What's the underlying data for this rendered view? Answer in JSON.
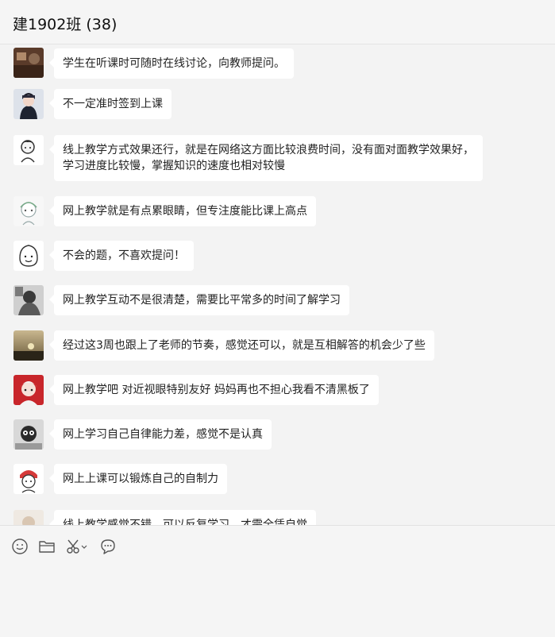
{
  "window": {
    "title": "建1902班 (38)"
  },
  "messages": [
    {
      "text": [
        "学生在听课时可随时在线讨论，向教师提问。"
      ]
    },
    {
      "text": [
        "不一定准时签到上课"
      ]
    },
    {
      "text": [
        "线上教学方式效果还行，就是在网络这方面比较浪费时间，没有面对面教学效果好，",
        "学习进度比较慢，掌握知识的速度也相对较慢"
      ]
    },
    {
      "text": [
        "网上教学就是有点累眼睛，但专注度能比课上高点"
      ]
    },
    {
      "text": [
        "不会的题，不喜欢提问！"
      ]
    },
    {
      "text": [
        "网上教学互动不是很清楚，需要比平常多的时间了解学习"
      ]
    },
    {
      "text": [
        "经过这3周也跟上了老师的节奏，感觉还可以，就是互相解答的机会少了些"
      ]
    },
    {
      "text": [
        "网上教学吧 对近视眼特别友好 妈妈再也不担心我看不清黑板了"
      ]
    },
    {
      "text": [
        "网上学习自己自律能力差，感觉不是认真"
      ]
    },
    {
      "text": [
        "网上上课可以锻炼自己的自制力"
      ]
    },
    {
      "text": [
        "线上教学感觉不错，可以反复学习，才需全凭自觉"
      ]
    }
  ],
  "toolbar": {
    "icons": [
      "emoji-icon",
      "folder-icon",
      "scissors-icon",
      "chat-history-icon"
    ]
  }
}
